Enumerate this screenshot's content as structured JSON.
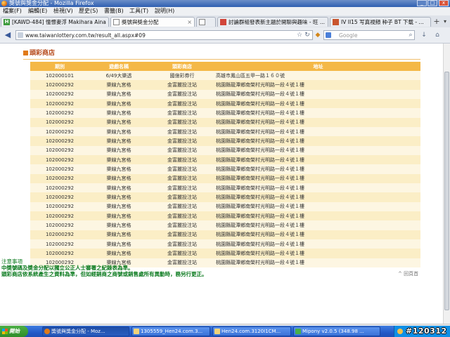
{
  "window": {
    "title": "獎號與獎金分配 - Mozilla Firefox",
    "minimize_glyph": "_",
    "maximize_glyph": "□",
    "close_glyph": "x"
  },
  "menu": {
    "items": [
      "檔案(F)",
      "編輯(E)",
      "檢視(V)",
      "歷史(S)",
      "書籤(B)",
      "工具(T)",
      "說明(H)"
    ]
  },
  "tabs": [
    {
      "label": "[KAWD-484] 憧憬麥浮 Makihara Aina ...",
      "favicon": "H",
      "active": false
    },
    {
      "label": "獎號與獎金分配",
      "favicon": "",
      "active": true
    },
    {
      "label": "",
      "favicon": "",
      "active": false
    },
    {
      "label": "討論群組發表新主題於開聊與趣味 - 旺 ...",
      "favicon": "",
      "active": false
    },
    {
      "label": "IV II15 写真視頻 种子 BT 下载 - ...",
      "favicon": "",
      "active": false
    }
  ],
  "nav": {
    "url": "www.taiwanlottery.com.tw/result_all.aspx#09",
    "search_placeholder": "Google",
    "back_icon": "back-arrow-icon",
    "home_icon": "home-icon"
  },
  "page": {
    "section_title": "頭彩商店",
    "table": {
      "headers": [
        "期別",
        "遊戲名稱",
        "頭彩商店",
        "地址"
      ],
      "rows": [
        [
          "102000101",
          "6/49大樂透",
          "國億彩券行",
          "高雄市鳳山區五甲一路１６０號"
        ],
        [
          "102000292",
          "樂線九宮格",
          "金富麗投注站",
          "桃園縣龍潭鄉南榮村光明路一段４號１樓"
        ],
        [
          "102000292",
          "樂線九宮格",
          "金富麗投注站",
          "桃園縣龍潭鄉南榮村光明路一段４號１樓"
        ],
        [
          "102000292",
          "樂線九宮格",
          "金富麗投注站",
          "桃園縣龍潭鄉南榮村光明路一段４號１樓"
        ],
        [
          "102000292",
          "樂線九宮格",
          "金富麗投注站",
          "桃園縣龍潭鄉南榮村光明路一段４號１樓"
        ],
        [
          "102000292",
          "樂線九宮格",
          "金富麗投注站",
          "桃園縣龍潭鄉南榮村光明路一段４號１樓"
        ],
        [
          "102000292",
          "樂線九宮格",
          "金富麗投注站",
          "桃園縣龍潭鄉南榮村光明路一段４號１樓"
        ],
        [
          "102000292",
          "樂線九宮格",
          "金富麗投注站",
          "桃園縣龍潭鄉南榮村光明路一段４號１樓"
        ],
        [
          "102000292",
          "樂線九宮格",
          "金富麗投注站",
          "桃園縣龍潭鄉南榮村光明路一段４號１樓"
        ],
        [
          "102000292",
          "樂線九宮格",
          "金富麗投注站",
          "桃園縣龍潭鄉南榮村光明路一段４號１樓"
        ],
        [
          "102000292",
          "樂線九宮格",
          "金富麗投注站",
          "桃園縣龍潭鄉南榮村光明路一段４號１樓"
        ],
        [
          "102000292",
          "樂線九宮格",
          "金富麗投注站",
          "桃園縣龍潭鄉南榮村光明路一段４號１樓"
        ],
        [
          "102000292",
          "樂線九宮格",
          "金富麗投注站",
          "桃園縣龍潭鄉南榮村光明路一段４號１樓"
        ],
        [
          "102000292",
          "樂線九宮格",
          "金富麗投注站",
          "桃園縣龍潭鄉南榮村光明路一段４號１樓"
        ],
        [
          "102000292",
          "樂線九宮格",
          "金富麗投注站",
          "桃園縣龍潭鄉南榮村光明路一段４號１樓"
        ],
        [
          "102000292",
          "樂線九宮格",
          "金富麗投注站",
          "桃園縣龍潭鄉南榮村光明路一段４號１樓"
        ],
        [
          "102000292",
          "樂線九宮格",
          "金富麗投注站",
          "桃園縣龍潭鄉南榮村光明路一段４號１樓"
        ],
        [
          "102000292",
          "樂線九宮格",
          "金富麗投注站",
          "桃園縣龍潭鄉南榮村光明路一段４號１樓"
        ],
        [
          "102000292",
          "樂線九宮格",
          "金富麗投注站",
          "桃園縣龍潭鄉南榮村光明路一段４號１樓"
        ],
        [
          "102000292",
          "樂線九宮格",
          "金富麗投注站",
          "桃園縣龍潭鄉南榮村光明路一段４號１樓"
        ],
        [
          "102000292",
          "樂線九宮格",
          "金富麗投注站",
          "桃園縣龍潭鄉南榮村光明路一段４號１樓"
        ]
      ]
    },
    "back_to_top": "^ 回頁首",
    "notes_title": "注意事項",
    "notes": [
      "中獎號碼及獎金分配以獨立公正人士審署之紀錄表為準。",
      "頭彩商店依系統產生之資料為準，但如經銷商之商號或銷售處所有異動時，務另行更正。"
    ]
  },
  "taskbar": {
    "start_label": "開始",
    "tasks": [
      {
        "label": "獎號與獎金分配 - Moz...",
        "active": true
      },
      {
        "label": "1305559_Hen24.com.3...",
        "active": false
      },
      {
        "label": "Hen24.com.3120I1CM...",
        "active": false
      },
      {
        "label": "Mipony v2.0.5 (348.98 ...",
        "active": false
      }
    ],
    "tray_text": "#120312"
  },
  "colors": {
    "table_header": "#f4b847",
    "row_odd": "#fdf6e2",
    "row_even": "#fbeec6",
    "section_title": "#b5481a",
    "notes": "#0a7a1e"
  }
}
